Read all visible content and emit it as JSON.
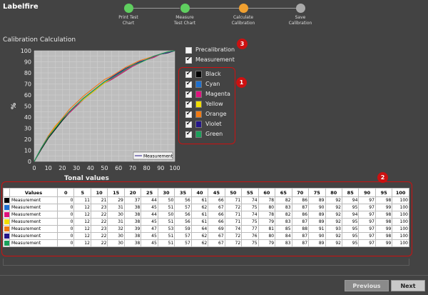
{
  "app": {
    "title": "Labelfire"
  },
  "steps": [
    {
      "label": "Print Test\nChart",
      "color": "#5fcf5f"
    },
    {
      "label": "Measure\nTest Chart",
      "color": "#5fcf5f"
    },
    {
      "label": "Calculate\nCalibration",
      "color": "#f0a030"
    },
    {
      "label": "Save\nCalibration",
      "color": "#aaaaaa"
    }
  ],
  "section_title": "Calibration Calculation",
  "options": {
    "precalibration": "Precalibration",
    "measurement": "Measurement",
    "precalibration_checked": false,
    "measurement_checked": true
  },
  "channels": [
    {
      "label": "Black",
      "color": "#000000",
      "checked": true
    },
    {
      "label": "Cyan",
      "color": "#1c6fd0",
      "checked": true
    },
    {
      "label": "Magenta",
      "color": "#e0117e",
      "checked": true
    },
    {
      "label": "Yellow",
      "color": "#f2de00",
      "checked": true
    },
    {
      "label": "Orange",
      "color": "#f27a12",
      "checked": true
    },
    {
      "label": "Violet",
      "color": "#24158a",
      "checked": true
    },
    {
      "label": "Green",
      "color": "#1aa05a",
      "checked": true
    }
  ],
  "badges": {
    "one": "1",
    "two": "2",
    "three": "3"
  },
  "chart_data": {
    "type": "line",
    "xlabel": "Tonal values",
    "ylabel": "%",
    "xlim": [
      0,
      100
    ],
    "ylim": [
      0,
      100
    ],
    "xticks": [
      0,
      10,
      20,
      30,
      40,
      50,
      60,
      70,
      80,
      90,
      100
    ],
    "yticks": [
      0,
      10,
      20,
      30,
      40,
      50,
      60,
      70,
      80,
      90,
      100
    ],
    "grid": true,
    "legend": {
      "position": "bottom-right",
      "entries": [
        "Measurement"
      ]
    },
    "x": [
      0,
      5,
      10,
      15,
      20,
      25,
      30,
      35,
      40,
      45,
      50,
      55,
      60,
      65,
      70,
      75,
      80,
      85,
      90,
      95,
      100
    ],
    "series": [
      {
        "name": "Black",
        "color": "#000000",
        "values": [
          0,
          11,
          21,
          29,
          37,
          44,
          50,
          56,
          61,
          66,
          71,
          74,
          78,
          82,
          86,
          89,
          92,
          94,
          97,
          98,
          100
        ]
      },
      {
        "name": "Cyan",
        "color": "#1c6fd0",
        "values": [
          0,
          12,
          23,
          31,
          38,
          45,
          51,
          57,
          62,
          67,
          72,
          75,
          80,
          83,
          87,
          90,
          92,
          95,
          97,
          99,
          100
        ]
      },
      {
        "name": "Magenta",
        "color": "#e0117e",
        "values": [
          0,
          12,
          22,
          30,
          38,
          44,
          50,
          56,
          61,
          66,
          71,
          74,
          78,
          82,
          86,
          89,
          92,
          94,
          97,
          98,
          100
        ]
      },
      {
        "name": "Yellow",
        "color": "#f2de00",
        "values": [
          0,
          12,
          22,
          31,
          38,
          45,
          51,
          56,
          61,
          66,
          71,
          75,
          79,
          83,
          87,
          89,
          92,
          95,
          97,
          98,
          100
        ]
      },
      {
        "name": "Orange",
        "color": "#f27a12",
        "values": [
          0,
          12,
          23,
          32,
          39,
          47,
          53,
          59,
          64,
          69,
          74,
          77,
          81,
          85,
          88,
          91,
          93,
          95,
          97,
          99,
          100
        ]
      },
      {
        "name": "Violet",
        "color": "#24158a",
        "values": [
          0,
          12,
          22,
          30,
          38,
          45,
          51,
          57,
          62,
          67,
          72,
          76,
          80,
          84,
          87,
          90,
          92,
          95,
          97,
          98,
          100
        ]
      },
      {
        "name": "Green",
        "color": "#1aa05a",
        "values": [
          0,
          12,
          22,
          30,
          38,
          45,
          51,
          57,
          62,
          67,
          72,
          75,
          79,
          83,
          87,
          89,
          92,
          95,
          97,
          99,
          100
        ]
      }
    ]
  },
  "table": {
    "header_label": "Values",
    "columns": [
      "0",
      "5",
      "10",
      "15",
      "20",
      "25",
      "30",
      "35",
      "40",
      "45",
      "50",
      "55",
      "60",
      "65",
      "70",
      "75",
      "80",
      "85",
      "90",
      "95",
      "100"
    ],
    "row_label": "Measurement"
  },
  "buttons": {
    "previous": "Previous",
    "next": "Next"
  }
}
